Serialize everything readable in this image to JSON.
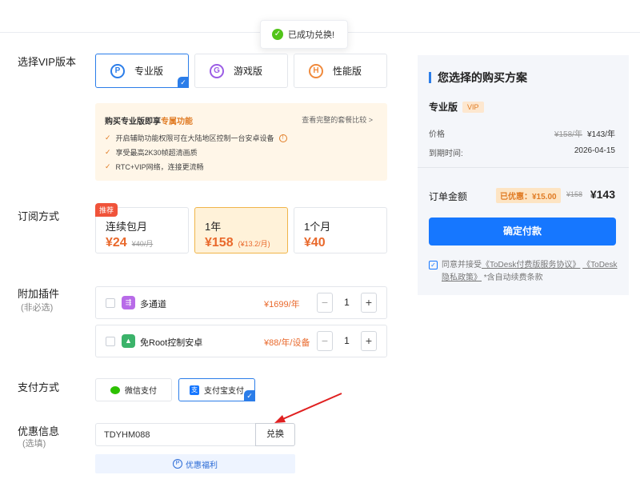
{
  "toast": {
    "text": "已成功兑换!"
  },
  "version": {
    "label": "选择VIP版本",
    "options": [
      {
        "icon": "P",
        "label": "专业版"
      },
      {
        "icon": "G",
        "label": "游戏版"
      },
      {
        "icon": "H",
        "label": "性能版"
      }
    ]
  },
  "features": {
    "title_prefix": "购买专业版即享",
    "title_highlight": "专属功能",
    "compare": "查看完整的套餐比较 >",
    "items": [
      "开启辅助功能权限可在大陆地区控制一台安卓设备",
      "享受最高2K30帧超清画质",
      "RTC+VIP网络，连接更流畅"
    ]
  },
  "subscription": {
    "label": "订阅方式",
    "plans": [
      {
        "badge": "推荐",
        "name": "连续包月",
        "price": "¥24",
        "old": "¥40/月",
        "per": ""
      },
      {
        "name": "1年",
        "price": "¥158",
        "per": "(¥13.2/月)",
        "old": ""
      },
      {
        "name": "1个月",
        "price": "¥40",
        "old": "",
        "per": ""
      }
    ]
  },
  "addons": {
    "label": "附加插件",
    "sublabel": "(非必选)",
    "items": [
      {
        "name": "多通道",
        "price": "¥1699/年",
        "qty": "1",
        "icon_color": "#b86be8"
      },
      {
        "name": "免Root控制安卓",
        "price": "¥88/年/设备",
        "qty": "1",
        "icon_color": "#3bb36a"
      }
    ]
  },
  "payment": {
    "label": "支付方式",
    "options": [
      {
        "label": "微信支付"
      },
      {
        "label": "支付宝支付"
      }
    ]
  },
  "coupon": {
    "label": "优惠信息",
    "sublabel": "(选填)",
    "code": "TDYHM088",
    "redeem": "兑换",
    "welfare": "优惠福利"
  },
  "summary": {
    "title": "您选择的购买方案",
    "edition": "专业版",
    "vip": "VIP",
    "price_label": "价格",
    "price_old": "¥158/年",
    "price_new": "¥143/年",
    "expire_label": "到期时间:",
    "expire": "2026-04-15",
    "total_label": "订单金额",
    "discount": "已优惠：¥15.00",
    "total_old": "¥158",
    "total": "¥143",
    "pay_button": "确定付款",
    "agree_prefix": "同意并接受",
    "agree_link1": "《ToDesk付费版服务协议》",
    "agree_link2": "《ToDesk隐私政策》",
    "agree_suffix": "*含自动续费条款"
  }
}
